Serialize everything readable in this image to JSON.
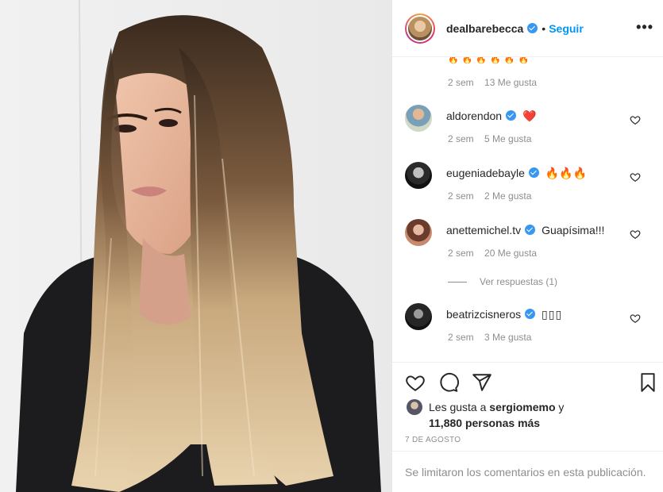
{
  "post": {
    "username": "dealbarebecca",
    "follow_label": "Seguir",
    "more_label": "•••"
  },
  "comments": {
    "top_partial": {
      "emoji_row": "🔥🔥🔥🔥🔥🔥",
      "time": "2 sem",
      "likes": "13 Me gusta"
    },
    "items": [
      {
        "username": "aldorendon",
        "text": "❤️",
        "time": "2 sem",
        "likes": "5 Me gusta"
      },
      {
        "username": "eugeniadebayle",
        "text": "🔥🔥🔥",
        "time": "2 sem",
        "likes": "2 Me gusta"
      },
      {
        "username": "anettemichel.tv",
        "text": "Guapísima!!!",
        "time": "2 sem",
        "likes": "20 Me gusta"
      },
      {
        "username": "beatrizcisneros",
        "text": "▯▯▯",
        "time": "2 sem",
        "likes": "3 Me gusta"
      }
    ],
    "view_replies": "Ver respuestas (1)"
  },
  "actions": {
    "like_icon": "heart-outline-icon",
    "comment_icon": "speech-bubble-icon",
    "share_icon": "paper-plane-icon",
    "save_icon": "bookmark-icon"
  },
  "likes": {
    "prefix": "Les gusta a ",
    "user": "sergiomemo",
    "suffix": " y",
    "count_line": "11,880 personas más"
  },
  "date": "7 DE AGOSTO",
  "footer_text": "Se limitaron los comentarios en esta publicación.",
  "colors": {
    "link_blue": "#0095f6",
    "verified_blue": "#3897f0",
    "heart_red": "#ed4956",
    "muted": "#8e8e8e"
  }
}
